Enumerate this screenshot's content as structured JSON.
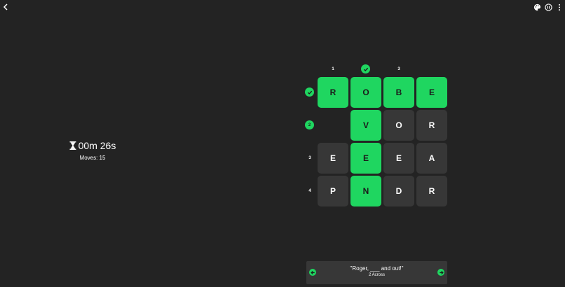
{
  "toolbar": {
    "back_icon": "chevron-left-icon",
    "palette_icon": "palette-icon",
    "pause_icon": "pause-icon",
    "more_icon": "more-vert-icon"
  },
  "stats": {
    "timer": "00m 26s",
    "moves": "Moves: 15"
  },
  "grid": {
    "columns": [
      "1",
      "",
      "3",
      ""
    ],
    "rows": [
      "",
      "2",
      "3",
      "4"
    ],
    "cells": [
      [
        {
          "letter": "R",
          "solved": true
        },
        {
          "letter": "O",
          "solved": true
        },
        {
          "letter": "B",
          "solved": true
        },
        {
          "letter": "E",
          "solved": true
        }
      ],
      [
        null,
        {
          "letter": "V",
          "solved": true
        },
        {
          "letter": "O",
          "solved": false
        },
        {
          "letter": "R",
          "solved": false
        }
      ],
      [
        {
          "letter": "E",
          "solved": false
        },
        {
          "letter": "E",
          "solved": true
        },
        {
          "letter": "E",
          "solved": false
        },
        {
          "letter": "A",
          "solved": false
        }
      ],
      [
        {
          "letter": "P",
          "solved": false
        },
        {
          "letter": "N",
          "solved": true
        },
        {
          "letter": "D",
          "solved": false
        },
        {
          "letter": "R",
          "solved": false
        }
      ]
    ],
    "active_row_badge": "2"
  },
  "clue": {
    "text": "\"Roger, ___ and out!\"",
    "label": "2 Across"
  },
  "colors": {
    "accent": "#1fd660",
    "tile": "#373737",
    "background": "#232323"
  }
}
